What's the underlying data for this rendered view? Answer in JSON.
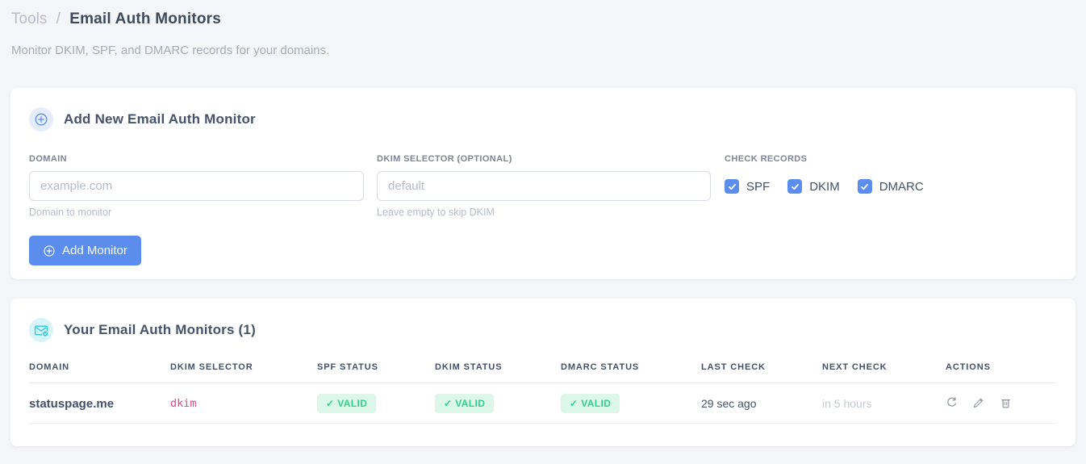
{
  "page": {
    "breadcrumb": {
      "parent": "Tools",
      "separator": "/",
      "current": "Email Auth Monitors"
    },
    "subtitle": "Monitor DKIM, SPF, and DMARC records for your domains."
  },
  "add_monitor_card": {
    "title": "Add New Email Auth Monitor",
    "title_icon": "circle-plus-icon",
    "fields": {
      "domain": {
        "label": "DOMAIN",
        "value": "",
        "placeholder": "example.com",
        "helper": "Domain to monitor"
      },
      "dkim_selector": {
        "label": "DKIM SELECTOR (OPTIONAL)",
        "value": "",
        "placeholder": "default",
        "helper": "Leave empty to skip DKIM"
      }
    },
    "check_records": {
      "label": "CHECK RECORDS",
      "options": [
        {
          "label": "SPF",
          "checked": true
        },
        {
          "label": "DKIM",
          "checked": true
        },
        {
          "label": "DMARC",
          "checked": true
        }
      ]
    },
    "submit_label": "Add Monitor",
    "submit_icon": "circle-plus-icon"
  },
  "monitors_card": {
    "title": "Your Email Auth Monitors (1)",
    "title_icon": "email-check-icon",
    "table": {
      "headers": [
        "DOMAIN",
        "DKIM SELECTOR",
        "SPF STATUS",
        "DKIM STATUS",
        "DMARC STATUS",
        "LAST CHECK",
        "NEXT CHECK",
        "ACTIONS"
      ],
      "rows": [
        {
          "domain": "statuspage.me",
          "dkim_selector": "dkim",
          "spf_status": "✓ VALID",
          "dkim_status": "✓ VALID",
          "dmarc_status": "✓ VALID",
          "last_check": "29 sec ago",
          "next_check": "in 5 hours",
          "action_icons": [
            "refresh-icon",
            "edit-icon",
            "delete-icon"
          ]
        }
      ]
    }
  },
  "colors": {
    "accent_blue": "#5a8dee",
    "badge_green_bg": "#dcf6e9",
    "badge_green_text": "#30d287",
    "selector_pink": "#e83e8c",
    "icon_teal": "#2cc9da"
  }
}
